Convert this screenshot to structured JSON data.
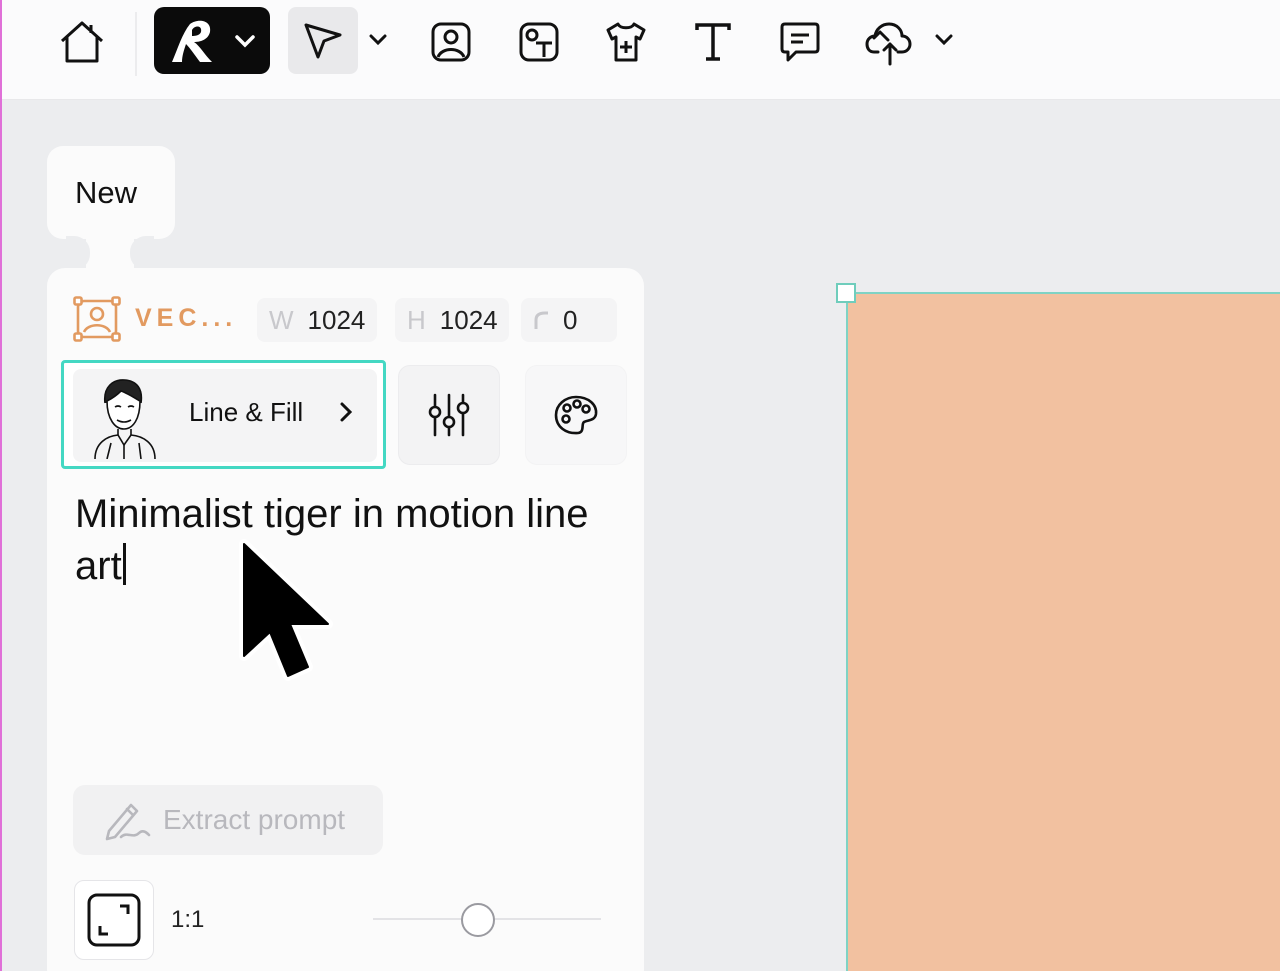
{
  "toolbar": {
    "tools": [
      {
        "name": "home",
        "icon": "home-icon"
      },
      {
        "name": "brand",
        "icon": "brand-logo-icon"
      },
      {
        "name": "select",
        "icon": "pointer-icon"
      },
      {
        "name": "image",
        "icon": "image-icon"
      },
      {
        "name": "image-text",
        "icon": "image-text-icon"
      },
      {
        "name": "tshirt",
        "icon": "tshirt-icon"
      },
      {
        "name": "text",
        "icon": "text-icon"
      },
      {
        "name": "comment",
        "icon": "comment-icon"
      },
      {
        "name": "upload",
        "icon": "cloud-upload-icon"
      }
    ]
  },
  "new_label": "New",
  "panel": {
    "type_label": "VEC...",
    "width_key": "W",
    "width_value": "1024",
    "height_key": "H",
    "height_value": "1024",
    "corner_value": "0",
    "style_name": "Line & Fill",
    "prompt_text": "Minimalist tiger in motion line art",
    "extract_label": "Extract prompt",
    "aspect_ratio": "1:1",
    "aspect_slider_fraction": 0.46
  },
  "colors": {
    "accent_teal": "#44d8c3",
    "type_orange": "#e29a60",
    "artboard_fill": "#f2c1a0"
  }
}
